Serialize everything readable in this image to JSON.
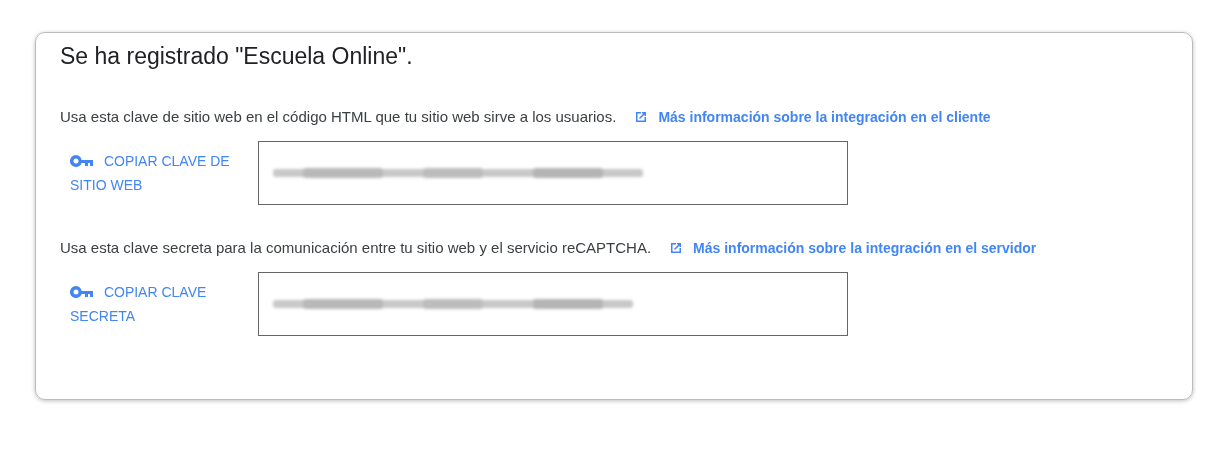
{
  "title": "Se ha registrado \"Escuela Online\".",
  "sections": [
    {
      "description": "Usa esta clave de sitio web en el código HTML que tu sitio web sirve a los usuarios.",
      "link": "Más información sobre la integración en el cliente",
      "copy_button": "COPIAR CLAVE DE SITIO WEB"
    },
    {
      "description": "Usa esta clave secreta para la comunicación entre tu sitio web y el servicio reCAPTCHA.",
      "link": "Más información sobre la integración en el servidor",
      "copy_button": "COPIAR CLAVE SECRETA"
    }
  ]
}
